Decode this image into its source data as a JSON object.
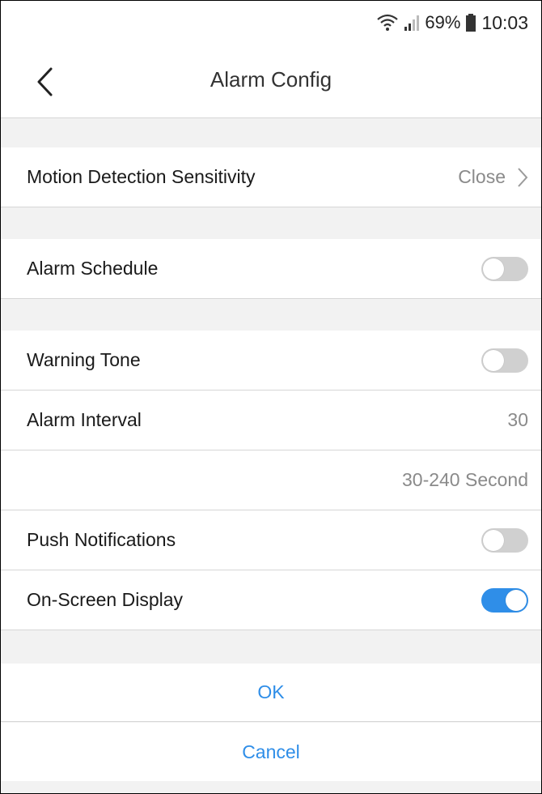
{
  "status_bar": {
    "battery": "69%",
    "time": "10:03",
    "icons": [
      "wifi-icon",
      "signal-icon",
      "battery-icon"
    ]
  },
  "header": {
    "title": "Alarm Config",
    "back_icon": "chevron-left-icon"
  },
  "settings": {
    "motion_detection": {
      "label": "Motion Detection Sensitivity",
      "value": "Close"
    },
    "alarm_schedule": {
      "label": "Alarm Schedule",
      "enabled": false
    },
    "warning_tone": {
      "label": "Warning Tone",
      "enabled": false
    },
    "alarm_interval": {
      "label": "Alarm Interval",
      "value": "30",
      "range_hint": "30-240 Second"
    },
    "push_notifications": {
      "label": "Push Notifications",
      "enabled": false
    },
    "on_screen_display": {
      "label": "On-Screen Display",
      "enabled": true
    }
  },
  "actions": {
    "ok_label": "OK",
    "cancel_label": "Cancel"
  },
  "colors": {
    "accent": "#2f8ee8",
    "toggle_off": "#d0d0d0",
    "background": "#f2f2f2"
  }
}
